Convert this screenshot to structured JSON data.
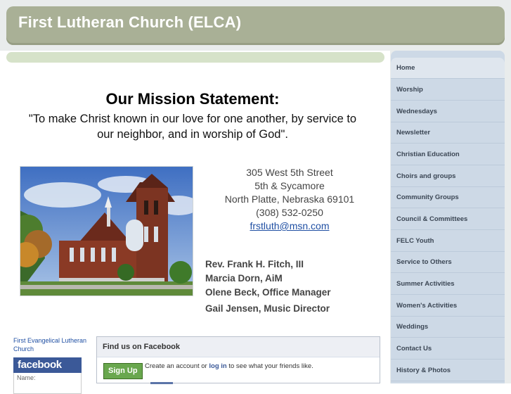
{
  "header": {
    "title": "First Lutheran Church (ELCA)"
  },
  "mission": {
    "title": "Our Mission Statement:",
    "line1": "\"To make Christ known in our love for one another, by service to",
    "line2": "our neighbor, and in worship of God\"."
  },
  "address": {
    "street": "305 West 5th Street",
    "cross": "5th & Sycamore",
    "city": "North Platte, Nebraska 69101",
    "phone": "(308) 532-0250",
    "email": "frstluth@msn.com"
  },
  "staff": [
    "Rev. Frank H. Fitch, III",
    "Marcia Dorn,  AiM",
    "Olene Beck, Office Manager",
    "Gail Jensen, Music Director"
  ],
  "facebook": {
    "org_name": "First Evangelical Lutheran Church",
    "logo": "facebook",
    "name_label": "Name:",
    "header": "Find us on Facebook",
    "signup": "Sign Up",
    "create_pre": "Create an account or",
    "login": "log in",
    "create_post": "to see what your friends like."
  },
  "nav": [
    "Home",
    "Worship",
    "Wednesdays",
    "Newsletter",
    "Christian Education",
    "Choirs and groups",
    "Community Groups",
    "Council & Committees",
    "FELC Youth",
    "Service to Others",
    "Summer Activities",
    "Women's Activities",
    "Weddings",
    "Contact Us",
    "History & Photos"
  ],
  "colors": {
    "header_bg": "#a9b096",
    "sidebar_bg": "#cdd9e6",
    "accent_bar": "#d6e2c9",
    "facebook_blue": "#3b5998"
  }
}
